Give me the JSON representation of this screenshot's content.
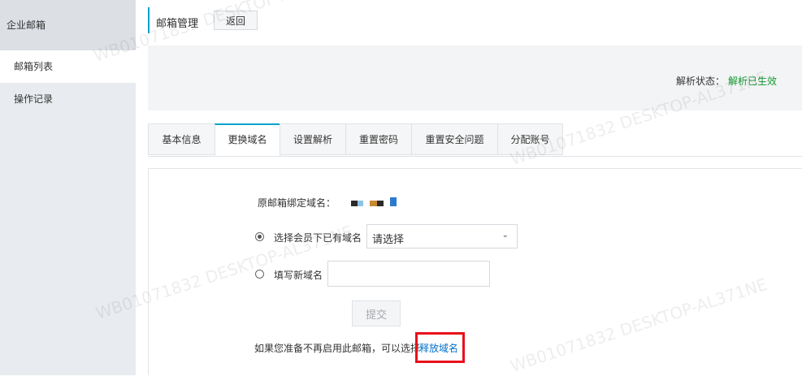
{
  "sidebar": {
    "title": "企业邮箱",
    "items": [
      {
        "label": "邮箱列表",
        "active": true
      },
      {
        "label": "操作记录",
        "active": false
      }
    ]
  },
  "header": {
    "title": "邮箱管理",
    "back_label": "返回"
  },
  "status": {
    "label": "解析状态：",
    "value": "解析已生效",
    "value_color": "#129a2f"
  },
  "tabs": [
    {
      "label": "基本信息",
      "active": false
    },
    {
      "label": "更换域名",
      "active": true
    },
    {
      "label": "设置解析",
      "active": false
    },
    {
      "label": "重置密码",
      "active": false
    },
    {
      "label": "重置安全问题",
      "active": false
    },
    {
      "label": "分配账号",
      "active": false
    }
  ],
  "form": {
    "original_domain_label": "原邮箱绑定域名：",
    "option_existing_label": "选择会员下已有域名",
    "select_value": "请选择",
    "option_new_label": "填写新域名",
    "new_domain_value": "",
    "submit_label": "提交",
    "footnote": "如果您准备不再启用此邮箱，可以选择",
    "release_link": "释放域名"
  },
  "watermark": "WB01071832 DESKTOP-AL371NE",
  "colors": {
    "accent": "#00a2ca",
    "link": "#0070cc",
    "highlight": "#e8101a"
  }
}
